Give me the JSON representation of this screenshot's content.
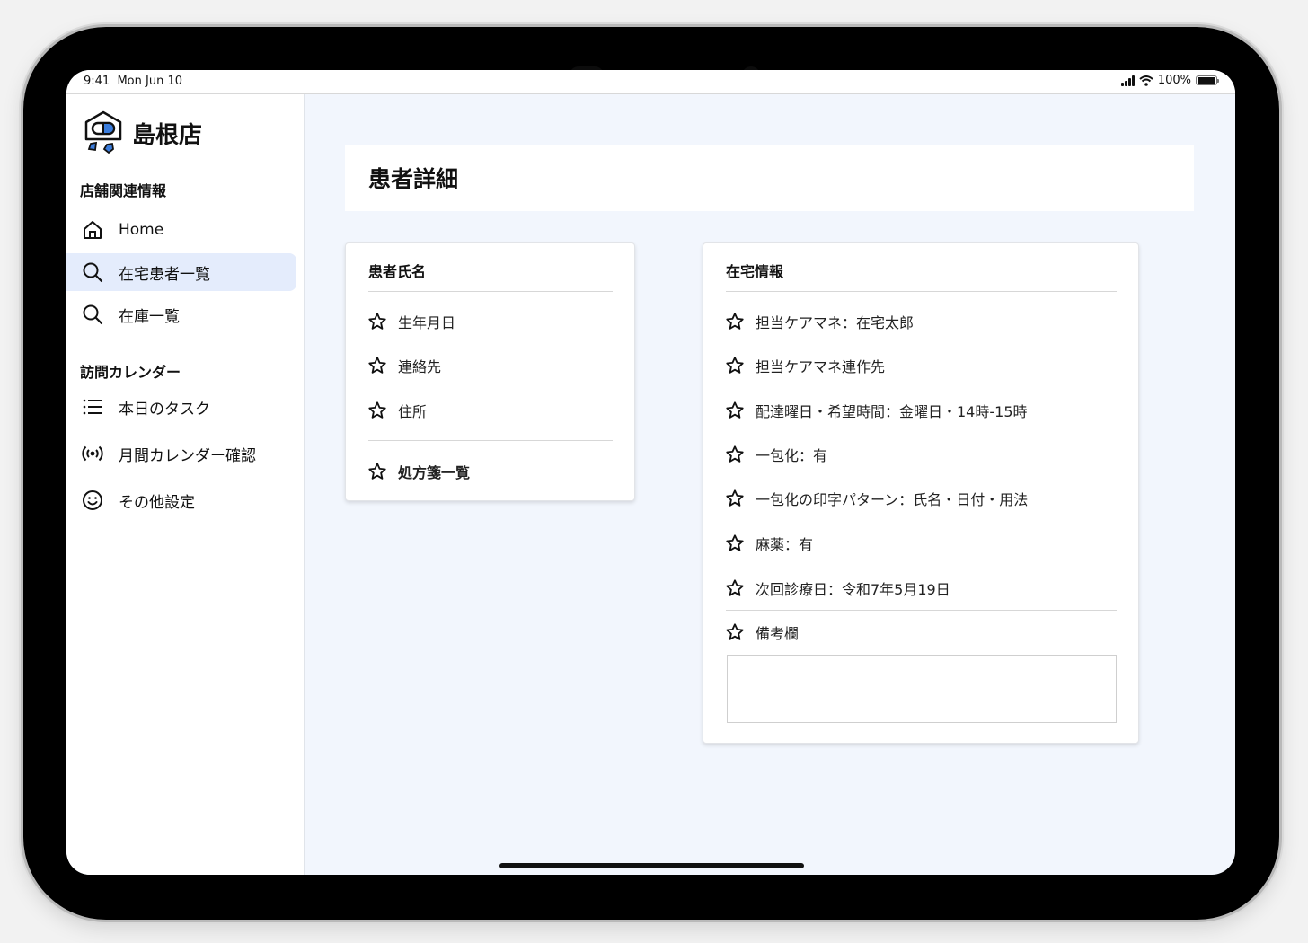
{
  "status_bar": {
    "time": "9:41",
    "date": "Mon Jun 10",
    "battery": "100%"
  },
  "sidebar": {
    "store_name": "島根店",
    "section1_label": "店舗関連情報",
    "section2_label": "訪問カレンダー",
    "items": [
      {
        "label": "Home",
        "icon": "home-icon",
        "active": false
      },
      {
        "label": "在宅患者一覧",
        "icon": "search-icon",
        "active": true
      },
      {
        "label": "在庫一覧",
        "icon": "search-icon",
        "active": false
      },
      {
        "label": "本日のタスク",
        "icon": "list-icon",
        "active": false
      },
      {
        "label": "月間カレンダー確認",
        "icon": "broadcast-icon",
        "active": false
      },
      {
        "label": "その他設定",
        "icon": "smiley-icon",
        "active": false
      }
    ]
  },
  "page": {
    "title": "患者詳細"
  },
  "patient_card": {
    "title": "患者氏名",
    "rows": [
      "生年月日",
      "連絡先",
      "住所"
    ],
    "prescription_link": "処方箋一覧"
  },
  "home_card": {
    "title": "在宅情報",
    "rows": [
      "担当ケアマネ：在宅太郎",
      "担当ケアマネ連作先",
      "配達曜日・希望時間：金曜日・14時-15時",
      "一包化：有",
      "一包化の印字パターン：氏名・日付・用法",
      "麻薬：有",
      "次回診療日：令和7年5月19日"
    ],
    "remarks_label": "備考欄",
    "remarks_value": ""
  },
  "colors": {
    "accent": "#e4ecfc",
    "logo_blue": "#3b7ddd",
    "background": "#f2f6fd"
  }
}
